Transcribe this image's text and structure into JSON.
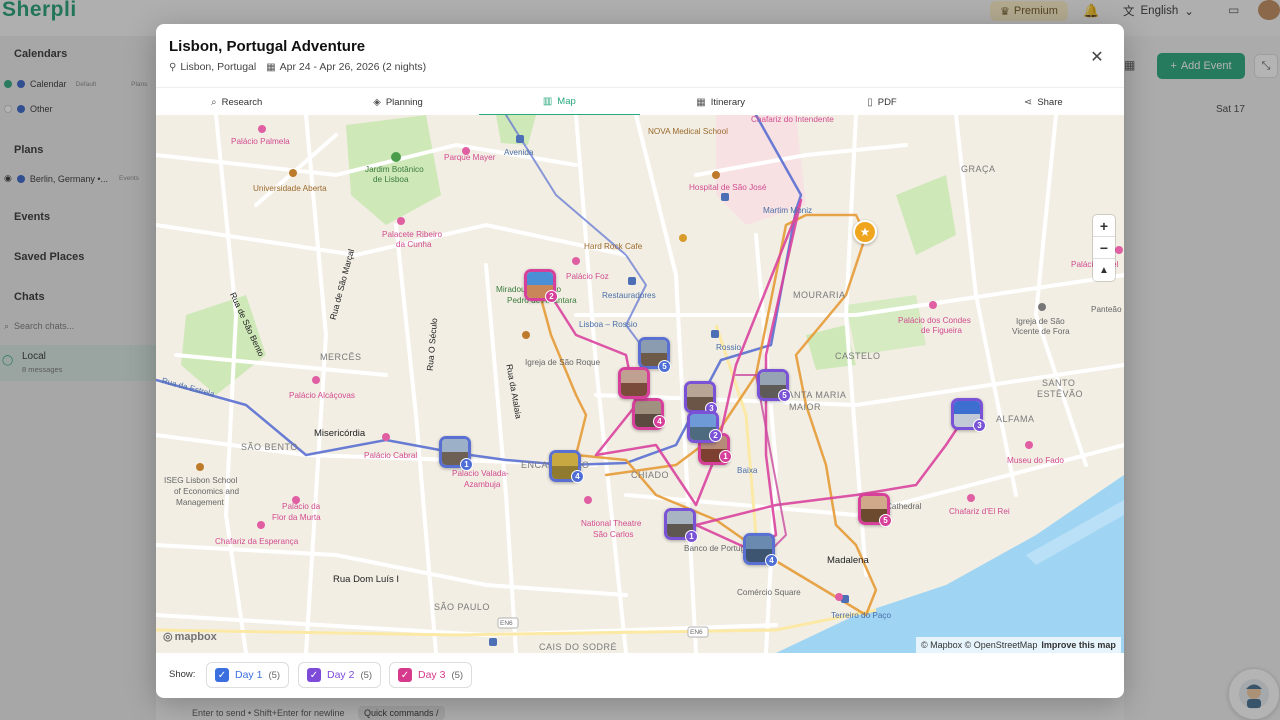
{
  "background": {
    "logo": "Sherpli",
    "premium": "Premium",
    "language": "English",
    "sidebar": {
      "calendars": "Calendars",
      "calendar_item": "Calendar",
      "calendar_default": "Default",
      "calendar_plans": "Plans",
      "other_item": "Other",
      "plans": "Plans",
      "plan_item": "Berlin, Germany •...",
      "plan_events": "Events",
      "events": "Events",
      "saved_places": "Saved Places",
      "chats": "Chats",
      "search_chats": "Search chats...",
      "local": "Local",
      "local_sub": "8 messages"
    },
    "add_event": "Add Event",
    "sat": "Sat 17",
    "hint": "Enter to send • Shift+Enter for newline",
    "quick_commands": "Quick commands  /"
  },
  "modal": {
    "title": "Lisbon, Portugal Adventure",
    "location": "Lisbon, Portugal",
    "dates": "Apr 24 - Apr 26, 2026 (2 nights)",
    "tabs": [
      {
        "label": "Research",
        "icon": "search-icon"
      },
      {
        "label": "Planning",
        "icon": "layers-icon"
      },
      {
        "label": "Map",
        "icon": "map-icon"
      },
      {
        "label": "Itinerary",
        "icon": "calendar-icon"
      },
      {
        "label": "PDF",
        "icon": "file-icon"
      },
      {
        "label": "Share",
        "icon": "share-icon"
      }
    ],
    "active_tab": "Map"
  },
  "map": {
    "labels": {
      "palacio_palmela": "Palácio Palmela",
      "parque_mayer": "Parque Mayer",
      "avenida": "Avenida",
      "nova_medical": "NOVA Medical School",
      "chafariz_intendente": "Chafariz do Intendente",
      "jardim_botanico": "Jardim Botânico",
      "jardim_botanico_2": "de Lisboa",
      "universidade_aberta": "Universidade Aberta",
      "hospital_sao_jose": "Hospital de São José",
      "martim_moniz": "Martim Moniz",
      "graca": "GRAÇA",
      "palacio_ribeiro": "Palacete Ribeiro",
      "palacio_ribeiro_2": "da Cunha",
      "hard_rock": "Hard Rock Cafe",
      "palacio_foz": "Palácio Foz",
      "restauradores": "Restauradores",
      "miradouro": "Miradouro de São",
      "miradouro_2": "Pedro de Alcântara",
      "lisboa_rossio": "Lisboa – Rossio",
      "mouraria": "MOURARIA",
      "palacio_sinel": "Palácio Sinel",
      "palacio_condes": "Palácio dos Condes",
      "palacio_condes_2": "de Figueira",
      "igreja_sao_vicente": "Igreja de São",
      "igreja_sao_vicente_2": "Vicente de Fora",
      "panteao": "Panteão",
      "rua_sao_bento": "Rua de São Bento",
      "rua_sao_marcal": "Rua de São Marçal",
      "rua_seculo": "Rua O Século",
      "rua_atalaia": "Rua da Atalaia",
      "merces": "MERCÊS",
      "igreja_sao_roque": "Igreja de São Roque",
      "rossio": "Rossio",
      "castelo": "CASTELO",
      "santa_maria_maior": "SANTA MARIA",
      "santa_maria_maior_2": "MAIOR",
      "santo_estevao": "SANTO",
      "santo_estevao_2": "ESTÊVÃO",
      "palacio_alcacovas": "Palácio Alcáçovas",
      "rua_estrela": "Rua da Estrela",
      "misericordia": "Misericórdia",
      "alfama": "ALFAMA",
      "sao_bento": "SÃO BENTO",
      "palacio_cabral": "Palácio Cabral",
      "palacio_valada": "Palácio Valada-",
      "palacio_valada_2": "Azambuja",
      "encarnacao": "ENCARNAÇÃO",
      "chiado": "CHIADO",
      "baixa": "Baixa",
      "museu_fado": "Museu do Fado",
      "iseg": "ISEG Lisbon School",
      "iseg_2": "of Economics and",
      "iseg_3": "Management",
      "palacio_flor": "Palácio da",
      "palacio_flor_2": "Flor da Murta",
      "cathedral": "Cathedral",
      "chafariz_el_rei": "Chafariz d'El Rei",
      "national_theatre": "National Theatre",
      "national_theatre_2": "São Carlos",
      "banco_portugal": "Banco de Portugal",
      "chafariz_esperanca": "Chafariz da Esperança",
      "madalena": "Madalena",
      "rua_dom_luis": "Rua Dom Luís I",
      "sao_paulo": "SÃO PAULO",
      "comercio": "Comércio Square",
      "terreiro_paco": "Terreiro do Paço",
      "en6_a": "EN6",
      "en6_b": "EN6",
      "cais_do_sodre": "CAIS DO SODRÉ"
    },
    "attribution": "© Mapbox © OpenStreetMap",
    "improve": "Improve this map",
    "mapbox_logo": "mapbox",
    "route_colors": {
      "day1": "#4f6fd6",
      "day2": "#e8942c",
      "day3": "#d6409a"
    },
    "pins": [
      {
        "num": "2",
        "day": "day3"
      },
      {
        "num": "5",
        "day": "day1"
      },
      {
        "num": "1",
        "day": "day1"
      },
      {
        "num": "4",
        "day": "day3"
      },
      {
        "num": "3",
        "day": "day2"
      },
      {
        "num": "5",
        "day": "day2"
      },
      {
        "num": "4",
        "day": "day1"
      },
      {
        "num": "1",
        "day": "day2"
      },
      {
        "num": "1",
        "day": "day3"
      },
      {
        "num": "2",
        "day": "day2"
      },
      {
        "num": "3",
        "day": "day3"
      },
      {
        "num": "4",
        "day": "day1"
      },
      {
        "num": "5",
        "day": "day3"
      }
    ]
  },
  "footer": {
    "show": "Show:",
    "days": [
      {
        "label": "Day 1",
        "count": "(5)",
        "color": "#3b6fe0"
      },
      {
        "label": "Day 2",
        "count": "(5)",
        "color": "#7d4bd8"
      },
      {
        "label": "Day 3",
        "count": "(5)",
        "color": "#d63a8c"
      }
    ]
  }
}
